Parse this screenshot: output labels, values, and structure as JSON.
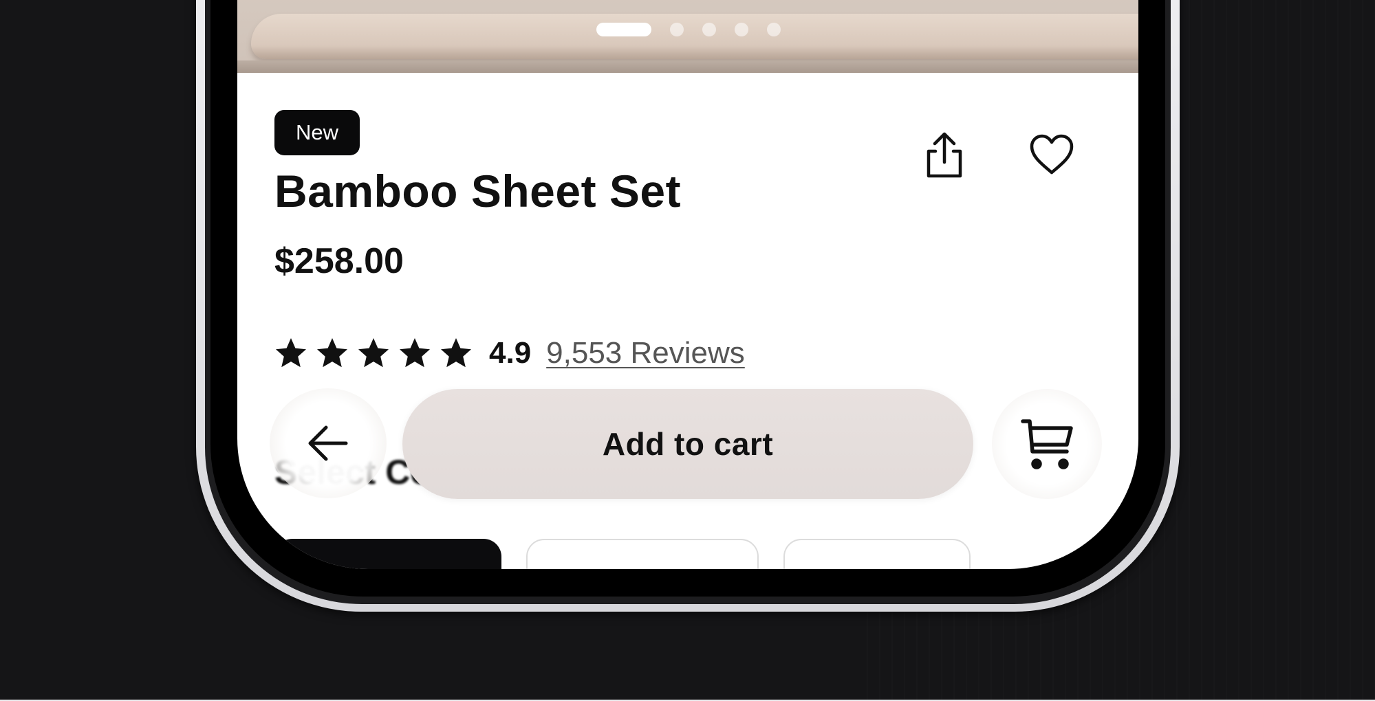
{
  "product": {
    "badge": "New",
    "title": "Bamboo Sheet Set",
    "price": "$258.00",
    "rating": {
      "score": "4.9",
      "stars": 5,
      "reviews_label": "9,553 Reviews"
    }
  },
  "carousel": {
    "slide_count": 5,
    "active_index": 0
  },
  "options": {
    "section_label": "Select Color"
  },
  "bottom_bar": {
    "add_to_cart_label": "Add to cart"
  },
  "icons": {
    "share": "share-icon",
    "favorite": "heart-icon",
    "star": "star-icon",
    "back": "arrow-left-icon",
    "cart": "cart-icon"
  },
  "colors": {
    "background": "#151517",
    "screen": "#ffffff",
    "text": "#111111",
    "badge": "#0a0a0b",
    "button": "#e5dedc"
  }
}
